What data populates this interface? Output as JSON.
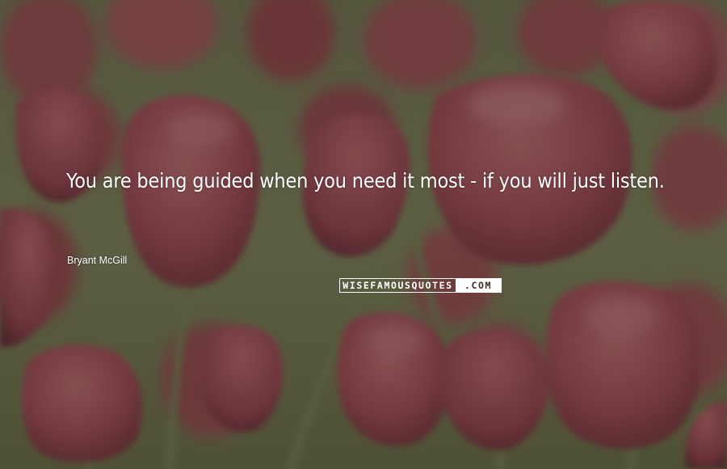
{
  "quote": {
    "text": "You are being guided when you need it most  -  if you will just listen.",
    "author": "Bryant McGill"
  },
  "watermark": {
    "left": "WISEFAMOUSQUOTES",
    "right": ".COM"
  },
  "colors": {
    "overlay": "#3b2f2b",
    "petal": "#b8505c",
    "stem": "#6f8a55"
  }
}
